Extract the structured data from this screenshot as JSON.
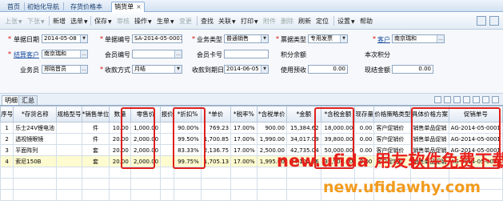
{
  "tabs": {
    "home": "首页",
    "init": "初始化导航",
    "price": "存货价格本",
    "current": "销货单",
    "close": "×"
  },
  "toolbar": {
    "prev": "上张",
    "next": "下张",
    "new": "新增",
    "copy": "选单",
    "save": "保存",
    "audit": "审核",
    "ops": "操作",
    "gen": "生单",
    "change": "变更",
    "find": "查找",
    "related": "关联",
    "print": "打印",
    "attach": "附件",
    "delete": "删除",
    "refresh": "刷新",
    "locate": "定位",
    "settings": "设置",
    "help": "帮助",
    "drop": "▼"
  },
  "form": {
    "date_label": "单据日期",
    "date_value": "2014-05-08",
    "no_label": "单据编号",
    "no_value": "SA-2014-05-0001",
    "biztype_label": "业务类型",
    "biztype_value": "普通销售",
    "invtype_label": "票据类型",
    "invtype_value": "专用发票",
    "customer_label": "客户",
    "customer_value": "南京瑞和",
    "settle_label": "结算客户",
    "settle_value": "南京瑞和",
    "member_label": "会员编号",
    "member_value": "",
    "card_label": "会员卡号",
    "card_value": "",
    "points_label": "积分余额",
    "points_value": "",
    "thispoints_label": "本次积分",
    "thispoints_value": "",
    "staff_label": "业务员",
    "staff_value": "郑晓晋员",
    "collect_label": "收款方式",
    "collect_value": "月结",
    "collectdate_label": "收款到期日",
    "collectdate_value": "2014-06-05",
    "prepay_label": "使用预收",
    "prepay_value": "0.00",
    "balance_label": "现结金额",
    "balance_value": "0.00",
    "ref_glyph": "…",
    "dd_glyph": "▼"
  },
  "subtabs": {
    "detail": "明细",
    "summary": "汇总"
  },
  "table": {
    "headers": [
      "序号",
      "*存货名称",
      "规格型号",
      "*销售单位",
      "数量",
      "零售价",
      "报价",
      "*折扣%",
      "*单价",
      "*税率%",
      "*含税单价",
      "*金额",
      "*含税金额",
      "现存量",
      "价格策略类型",
      "具体价格方案",
      "促销单号"
    ],
    "rows": [
      [
        "1",
        "乐士24V锂电池",
        "",
        "件",
        "10.00",
        "1,000.00",
        "",
        "90.00%",
        "769.23",
        "17.00%",
        "900.00",
        "15,384.62",
        "18,000.00",
        "0.00",
        "客户促销价",
        "销售单品促销",
        "AG-2014-05-0001"
      ],
      [
        "2",
        "透视镜眼镜",
        "",
        "件",
        "20.00",
        "2,000.00",
        "",
        "99.50%",
        "1,700.85",
        "17.00%",
        "1,990.00",
        "34,017.09",
        "39,800.00",
        "0.00",
        "客户促销价",
        "销售单品促销",
        "AG-2014-05-0001"
      ],
      [
        "3",
        "平面阵列",
        "",
        "套",
        "20.00",
        "2,000.00",
        "",
        "83.33%",
        "2,136.75",
        "17.00%",
        "2,500.00",
        "42,735.04",
        "50,000.00",
        "0.00",
        "客户促销价",
        "销售单品促销",
        "AG-2014-05-0001"
      ],
      [
        "4",
        "索尼150B",
        "",
        "套",
        "20.00",
        "2,000.00",
        "",
        "99.75%",
        "1,705.13",
        "17.00%",
        "1,995.00",
        "34,102.56",
        "39,900.00",
        "0.00",
        "客户促销价",
        "销售单品促销",
        "AG-2014-05-0001"
      ]
    ]
  },
  "watermark": {
    "line1": "new.ufida 用友软件免费下载",
    "line2": "new.ufidawhy.com"
  },
  "colors": {
    "highlight": "#e0211d",
    "selected_row": "#fffbd0",
    "watermark_red": "#e8201b",
    "watermark_orange": "#f29b1d"
  }
}
